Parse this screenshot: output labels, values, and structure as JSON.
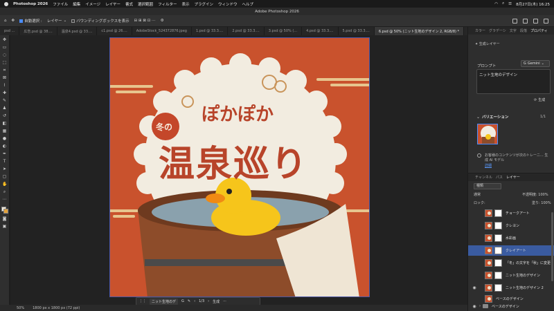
{
  "menubar": {
    "app": "Photoshop 2026",
    "items": [
      "ファイル",
      "編集",
      "イメージ",
      "レイヤー",
      "書式",
      "選択範囲",
      "フィルター",
      "表示",
      "プラグイン",
      "ウィンドウ",
      "ヘルプ"
    ],
    "clock": "8月27日(木) 16:25"
  },
  "window": {
    "title": "Adobe Photoshop 2026"
  },
  "options": {
    "auto_select_label": "自動選択 :",
    "auto_select_target": "レイヤー",
    "bounding_box_label": "バウンディングボックスを表示"
  },
  "tabs": [
    {
      "label": "psd ..."
    },
    {
      "label": "広告.psd @ 38...."
    },
    {
      "label": "温泉4.psd @ 33...."
    },
    {
      "label": "c1.psd @ 26...."
    },
    {
      "label": "AdobeStock_524372876.jpeg"
    },
    {
      "label": "1.psd @ 33.3...."
    },
    {
      "label": "2.psd @ 33.3...."
    },
    {
      "label": "3.psd @ 50% (..."
    },
    {
      "label": "4.psd @ 33.3...."
    },
    {
      "label": "5.psd @ 33.3...."
    },
    {
      "label": "6.psd @ 50% (ニット生地のデザイン 2, RGB/8) *"
    }
  ],
  "artwork": {
    "title_small": "ぽかぽか",
    "badge": "冬の",
    "title_main": "温泉巡り"
  },
  "floatbar": {
    "field": "ニット生地のデ",
    "page": "1/3",
    "generate": "生成"
  },
  "status": {
    "zoom": "50%",
    "size": "1800 px x 1800 px (72 ppi)"
  },
  "panel_tabs": [
    "カラー",
    "グラデーシ",
    "文字",
    "段落",
    "プロパティ"
  ],
  "properties": {
    "section": "生成レイヤー",
    "prompt_label": "プロンプト",
    "model": "Gemini",
    "prompt_text": "ニット生地のデザイン",
    "generate_label": "生成",
    "variation_title": "バリエーション",
    "variation_count": "1/1",
    "note": "お客様のコンテンツが次のトレーニ... 生成 AI モデル",
    "link": "詳細"
  },
  "layer_tabs": [
    "チャンネル",
    "パス",
    "レイヤー"
  ],
  "layers_panel": {
    "filter": "種類",
    "blend": "通常",
    "opacity": "不透明度: 100%",
    "lock": "ロック:",
    "fill": "塗り: 100%",
    "rows": [
      {
        "name": "チョークアート",
        "visible": false
      },
      {
        "name": "クレヨン",
        "visible": false
      },
      {
        "name": "水彩画",
        "visible": false
      },
      {
        "name": "クレイアート",
        "visible": false
      },
      {
        "name": "「冬」の文字を「秋」に変更",
        "visible": false
      },
      {
        "name": "ニット生地のデザイン",
        "visible": false
      },
      {
        "name": "ニット生地のデザイン 2",
        "visible": true
      },
      {
        "name": "ベースのデザイン",
        "visible": true
      }
    ],
    "group": "ベースのデザイン"
  },
  "colors": {
    "accent": "#4a8cff",
    "background": "#c9522d",
    "foreground_swatch": "#f0e9da",
    "background_swatch": "#e3a13a"
  }
}
